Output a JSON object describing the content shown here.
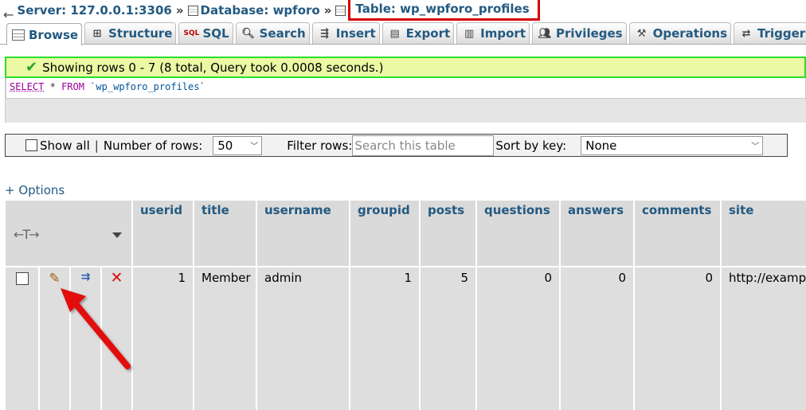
{
  "breadcrumb": {
    "back": "←",
    "server": "Server: 127.0.0.1:3306",
    "sep1": "»",
    "database": "Database: wpforo",
    "sep2": "»",
    "table": "Table: wp_wpforo_profiles"
  },
  "tabs": [
    {
      "label": "Browse",
      "icon": "browse-icon",
      "active": true
    },
    {
      "label": "Structure",
      "icon": "structure-icon"
    },
    {
      "label": "SQL",
      "icon": "sql-icon"
    },
    {
      "label": "Search",
      "icon": "search-icon"
    },
    {
      "label": "Insert",
      "icon": "insert-icon"
    },
    {
      "label": "Export",
      "icon": "export-icon"
    },
    {
      "label": "Import",
      "icon": "import-icon"
    },
    {
      "label": "Privileges",
      "icon": "privileges-icon"
    },
    {
      "label": "Operations",
      "icon": "operations-icon"
    },
    {
      "label": "Trigger",
      "icon": "triggers-icon"
    }
  ],
  "message": "Showing rows 0 - 7 (8 total, Query took 0.0008 seconds.)",
  "sql": {
    "select": "SELECT",
    "star": "*",
    "from": "FROM",
    "table": "`wp_wpforo_profiles`"
  },
  "navbar": {
    "show_all": "Show all",
    "sep": "|",
    "num_rows_label": "Number of rows:",
    "num_rows_value": "50",
    "filter_label": "Filter rows:",
    "filter_placeholder": "Search this table",
    "sort_label": "Sort by key:",
    "sort_value": "None"
  },
  "options_link": "+ Options",
  "columns": [
    "userid",
    "title",
    "username",
    "groupid",
    "posts",
    "questions",
    "answers",
    "comments",
    "site"
  ],
  "rows": [
    {
      "userid": "1",
      "title": "Member",
      "username": "admin",
      "groupid": "1",
      "posts": "5",
      "questions": "0",
      "answers": "0",
      "comments": "0",
      "site": "http://example"
    }
  ],
  "colors": {
    "link": "#235a81",
    "success_border": "#2adf2a",
    "success_bg": "#ebf8a4",
    "highlight": "#d40000"
  }
}
